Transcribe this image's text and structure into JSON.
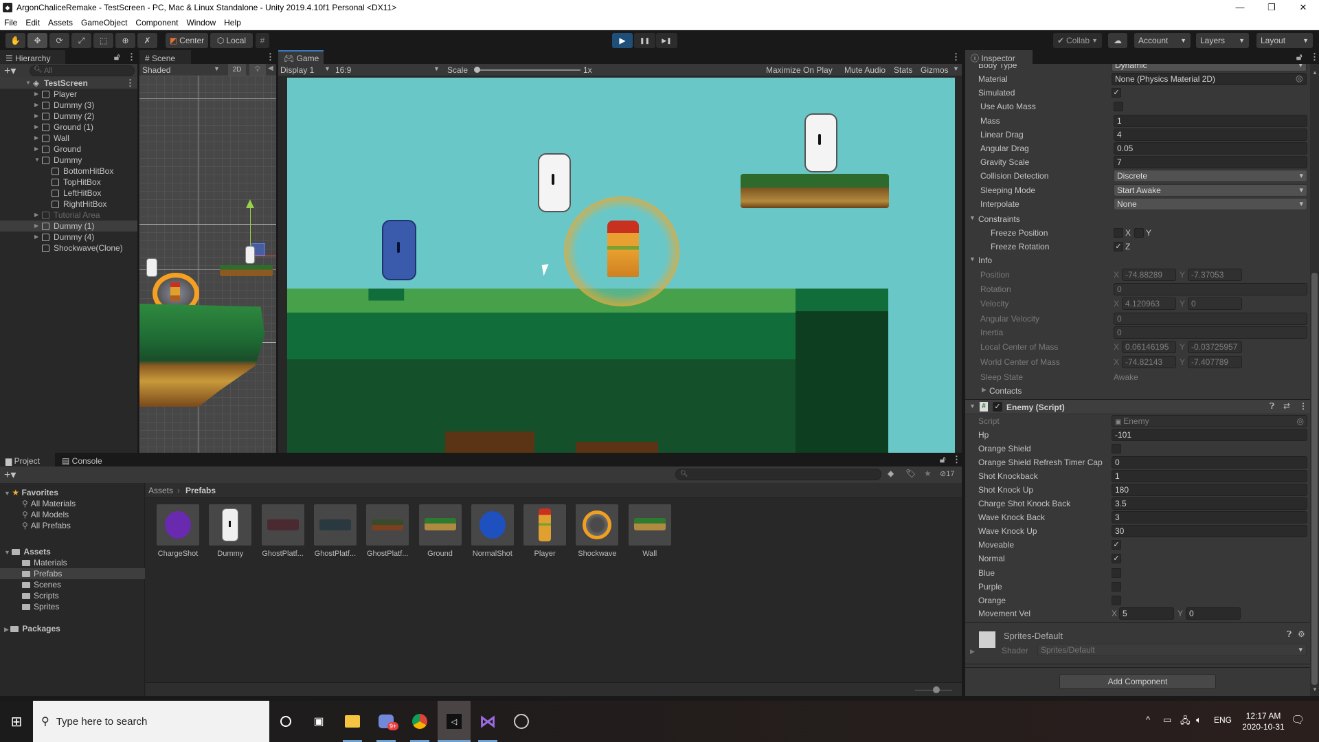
{
  "window": {
    "title": "ArgonChaliceRemake - TestScreen - PC, Mac & Linux Standalone - Unity 2019.4.10f1 Personal <DX11>",
    "minimize": "—",
    "maximize": "❐",
    "close": "✕"
  },
  "menu": [
    "File",
    "Edit",
    "Assets",
    "GameObject",
    "Component",
    "Window",
    "Help"
  ],
  "toolbar": {
    "tools": [
      "hand-tool",
      "move-tool",
      "rotate-tool",
      "scale-tool",
      "rect-tool",
      "transform-tool",
      "custom-tool"
    ],
    "pivot_mode": "Center",
    "pivot_rotation": "Local",
    "play": "▶",
    "pause": "❚❚",
    "step": "▶❚",
    "collab": "Collab",
    "account": "Account",
    "layers": "Layers",
    "layout": "Layout"
  },
  "hierarchy": {
    "tab": "Hierarchy",
    "search_placeholder": "All",
    "scene": "TestScreen",
    "items": [
      {
        "label": "Player",
        "depth": 1,
        "expandable": true
      },
      {
        "label": "Dummy (3)",
        "depth": 1,
        "expandable": true
      },
      {
        "label": "Dummy (2)",
        "depth": 1,
        "expandable": true
      },
      {
        "label": "Ground (1)",
        "depth": 1,
        "expandable": true
      },
      {
        "label": "Wall",
        "depth": 1,
        "expandable": true
      },
      {
        "label": "Ground",
        "depth": 1,
        "expandable": true
      },
      {
        "label": "Dummy",
        "depth": 1,
        "expandable": true,
        "expanded": true
      },
      {
        "label": "BottomHitBox",
        "depth": 2
      },
      {
        "label": "TopHitBox",
        "depth": 2
      },
      {
        "label": "LeftHitBox",
        "depth": 2
      },
      {
        "label": "RightHitBox",
        "depth": 2
      },
      {
        "label": "Tutorial Area",
        "depth": 1,
        "expandable": true,
        "inactive": true
      },
      {
        "label": "Dummy (1)",
        "depth": 1,
        "expandable": true,
        "selected": true
      },
      {
        "label": "Dummy (4)",
        "depth": 1,
        "expandable": true
      },
      {
        "label": "Shockwave(Clone)",
        "depth": 1
      }
    ]
  },
  "scene": {
    "tab": "Scene",
    "shading": "Shaded",
    "mode_2d": "2D"
  },
  "game": {
    "tab": "Game",
    "display": "Display 1",
    "aspect": "16:9",
    "scale_label": "Scale",
    "scale_value": "1x",
    "maximize_on_play": "Maximize On Play",
    "mute_audio": "Mute Audio",
    "stats": "Stats",
    "gizmos": "Gizmos"
  },
  "inspector": {
    "tab": "Inspector",
    "rigidbody": {
      "body_type_label": "Body Type",
      "body_type": "Dynamic",
      "rows": [
        {
          "label": "Material",
          "type": "object",
          "value": "None (Physics Material 2D)"
        },
        {
          "label": "Simulated",
          "type": "check",
          "value": true
        },
        {
          "label": "Use Auto Mass",
          "type": "check",
          "value": false
        },
        {
          "label": "Mass",
          "type": "text",
          "value": "1"
        },
        {
          "label": "Linear Drag",
          "type": "text",
          "value": "4"
        },
        {
          "label": "Angular Drag",
          "type": "text",
          "value": "0.05"
        },
        {
          "label": "Gravity Scale",
          "type": "text",
          "value": "7"
        },
        {
          "label": "Collision Detection",
          "type": "dropdown",
          "value": "Discrete"
        },
        {
          "label": "Sleeping Mode",
          "type": "dropdown",
          "value": "Start Awake"
        },
        {
          "label": "Interpolate",
          "type": "dropdown",
          "value": "None"
        }
      ],
      "constraints_label": "Constraints",
      "freeze_position_label": "Freeze Position",
      "freeze_position": {
        "x": false,
        "y": false
      },
      "freeze_rotation_label": "Freeze Rotation",
      "freeze_rotation": {
        "z": true
      },
      "info_label": "Info",
      "info": {
        "position_label": "Position",
        "position": {
          "x": "-74.88289",
          "y": "-7.37053"
        },
        "rotation_label": "Rotation",
        "rotation": "0",
        "velocity_label": "Velocity",
        "velocity": {
          "x": "4.120963",
          "y": "0"
        },
        "angular_velocity_label": "Angular Velocity",
        "angular_velocity": "0",
        "inertia_label": "Inertia",
        "inertia": "0",
        "local_com_label": "Local Center of Mass",
        "local_com": {
          "x": "0.06146195",
          "y": "-0.03725957"
        },
        "world_com_label": "World Center of Mass",
        "world_com": {
          "x": "-74.82143",
          "y": "-7.407789"
        },
        "sleep_state_label": "Sleep State",
        "sleep_state": "Awake",
        "contacts_label": "Contacts"
      }
    },
    "enemy_script": {
      "title": "Enemy (Script)",
      "enabled": true,
      "script_label": "Script",
      "script": "Enemy",
      "rows": [
        {
          "label": "Hp",
          "type": "text",
          "value": "-101"
        },
        {
          "label": "Orange Shield",
          "type": "check",
          "value": false
        },
        {
          "label": "Orange Shield Refresh Timer Cap",
          "type": "text",
          "value": "0"
        },
        {
          "label": "Shot Knockback",
          "type": "text",
          "value": "1"
        },
        {
          "label": "Shot Knock Up",
          "type": "text",
          "value": "180"
        },
        {
          "label": "Charge Shot Knock Back",
          "type": "text",
          "value": "3.5"
        },
        {
          "label": "Wave Knock Back",
          "type": "text",
          "value": "3"
        },
        {
          "label": "Wave Knock Up",
          "type": "text",
          "value": "30"
        },
        {
          "label": "Moveable",
          "type": "check",
          "value": true
        },
        {
          "label": "Normal",
          "type": "check",
          "value": true
        },
        {
          "label": "Blue",
          "type": "check",
          "value": false
        },
        {
          "label": "Purple",
          "type": "check",
          "value": false
        },
        {
          "label": "Orange",
          "type": "check",
          "value": false
        }
      ],
      "movement_vel_label": "Movement Vel",
      "movement_vel": {
        "x": "5",
        "y": "0"
      }
    },
    "material": {
      "name": "Sprites-Default",
      "shader_label": "Shader",
      "shader": "Sprites/Default"
    },
    "add_component": "Add Component"
  },
  "project": {
    "tab": "Project",
    "console_tab": "Console",
    "favorites_label": "Favorites",
    "favorites": [
      "All Materials",
      "All Models",
      "All Prefabs"
    ],
    "assets_label": "Assets",
    "asset_folders": [
      "Materials",
      "Prefabs",
      "Scenes",
      "Scripts",
      "Sprites"
    ],
    "selected_folder": "Prefabs",
    "packages_label": "Packages",
    "breadcrumb": [
      "Assets",
      "Prefabs"
    ],
    "hidden_count": "17",
    "assets": [
      {
        "name": "ChargeShot",
        "kind": "purple-circle"
      },
      {
        "name": "Dummy",
        "kind": "dummy"
      },
      {
        "name": "GhostPlatf...",
        "kind": "ghost-red"
      },
      {
        "name": "GhostPlatf...",
        "kind": "ghost-blue"
      },
      {
        "name": "GhostPlatf...",
        "kind": "ghost-orange"
      },
      {
        "name": "Ground",
        "kind": "platform"
      },
      {
        "name": "NormalShot",
        "kind": "blue-circle"
      },
      {
        "name": "Player",
        "kind": "player"
      },
      {
        "name": "Shockwave",
        "kind": "ring"
      },
      {
        "name": "Wall",
        "kind": "platform"
      }
    ]
  },
  "taskbar": {
    "search_placeholder": "Type here to search",
    "discord_badge": "9+",
    "language": "ENG",
    "time": "12:17 AM",
    "date": "2020-10-31"
  },
  "colors": {
    "play_active": "#1f4e79",
    "tab_accent": "#3a79bb",
    "game_sky": "#6ac7c8"
  }
}
